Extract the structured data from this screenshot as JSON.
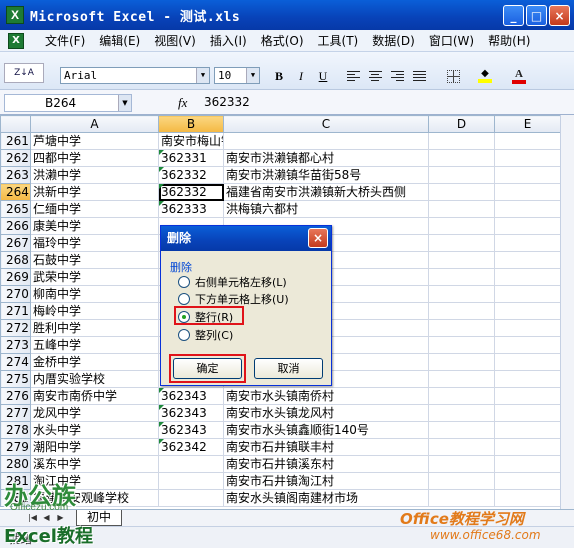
{
  "window": {
    "title": "Microsoft Excel - 测试.xls",
    "app_icon": "X",
    "min": "_",
    "max": "□",
    "close": "×"
  },
  "menu": [
    "文件(F)",
    "编辑(E)",
    "视图(V)",
    "插入(I)",
    "格式(O)",
    "工具(T)",
    "数据(D)",
    "窗口(W)",
    "帮助(H)"
  ],
  "toolbar": {
    "font": "Arial",
    "size": "10",
    "bold": "B",
    "italic": "I",
    "underline": "U",
    "sort_label": "Z↓A"
  },
  "formula": {
    "cell": "B264",
    "fx": "fx",
    "value": "362332"
  },
  "columns": [
    "A",
    "B",
    "C",
    "D",
    "E"
  ],
  "rows": [
    {
      "n": "261",
      "a": "芦塘中学",
      "b": "南安市梅山镇格内村",
      "c": ""
    },
    {
      "n": "262",
      "a": "四都中学",
      "b": "362331",
      "c": "南安市洪濑镇都心村"
    },
    {
      "n": "263",
      "a": "洪濑中学",
      "b": "362332",
      "c": "南安市洪濑镇华苗街58号"
    },
    {
      "n": "264",
      "a": "洪新中学",
      "b": "362332",
      "c": "福建省南安市洪濑镇新大桥头西侧"
    },
    {
      "n": "265",
      "a": "仁缅中学",
      "b": "362333",
      "c": "洪梅镇六都村"
    },
    {
      "n": "266",
      "a": "康美中学",
      "b": "",
      "c": ""
    },
    {
      "n": "267",
      "a": "福玲中学",
      "b": "",
      "c": ""
    },
    {
      "n": "268",
      "a": "石鼓中学",
      "b": "",
      "c": ""
    },
    {
      "n": "269",
      "a": "武荣中学",
      "b": "",
      "c": "工业区1100号"
    },
    {
      "n": "270",
      "a": "柳南中学",
      "b": "",
      "c": "街20号"
    },
    {
      "n": "271",
      "a": "梅岭中学",
      "b": "",
      "c": ""
    },
    {
      "n": "272",
      "a": "胜利中学",
      "b": "",
      "c": ""
    },
    {
      "n": "273",
      "a": "五峰中学",
      "b": "",
      "c": ""
    },
    {
      "n": "274",
      "a": "金桥中学",
      "b": "",
      "c": "区53号"
    },
    {
      "n": "275",
      "a": "内厝实验学校",
      "b": "",
      "c": "镇内厝村"
    },
    {
      "n": "276",
      "a": "南安市南侨中学",
      "b": "362343",
      "c": "南安市水头镇南侨村"
    },
    {
      "n": "277",
      "a": "龙风中学",
      "b": "362343",
      "c": "南安市水头镇龙风村"
    },
    {
      "n": "278",
      "a": "水头中学",
      "b": "362343",
      "c": "南安市水头镇鑫顺街140号"
    },
    {
      "n": "279",
      "a": "潮阳中学",
      "b": "362342",
      "c": "南安市石井镇联丰村"
    },
    {
      "n": "280",
      "a": "溪东中学",
      "b": "",
      "c": "南安市石井镇溪东村"
    },
    {
      "n": "281",
      "a": "淘江中学",
      "b": "",
      "c": "南安市石井镇淘江村"
    },
    {
      "n": "282",
      "a": "福建南安观峰学校",
      "b": "",
      "c": "南安水头镇阁南建材市场"
    }
  ],
  "sheet_tab": "初中",
  "status": "就绪",
  "dialog": {
    "title": "删除",
    "group": "删除",
    "options": [
      "右侧单元格左移(L)",
      "下方单元格上移(U)",
      "整行(R)",
      "整列(C)"
    ],
    "selected": "整行(R)",
    "ok": "确定",
    "cancel": "取消"
  },
  "watermark": {
    "logo": "办公族",
    "site": "Officezu.com",
    "excel": "Excel教程",
    "right1": "Office教程学习网",
    "right2": "www.office68.com"
  },
  "colors": {
    "title_blue": "#0842b8",
    "highlight_red": "#e0131a",
    "selected_header": "#f4b843"
  }
}
